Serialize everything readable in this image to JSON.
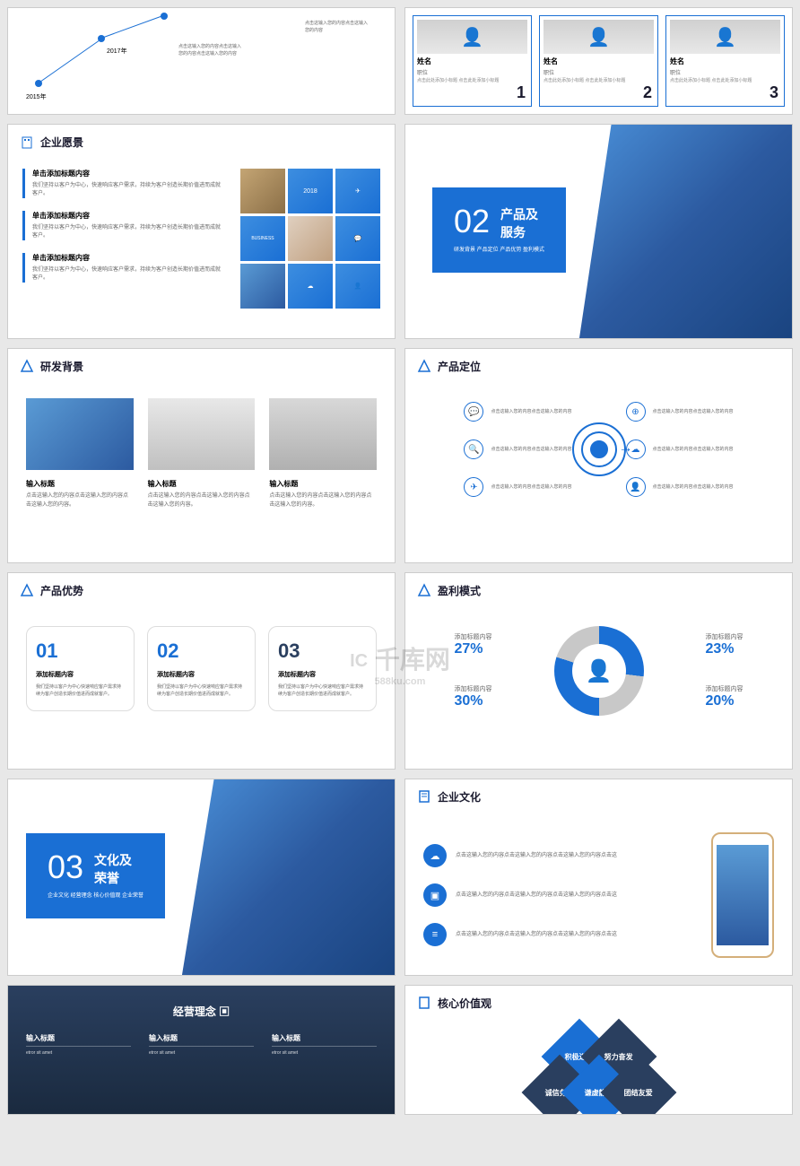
{
  "watermark": {
    "main": "千库网",
    "sub": "588ku.com",
    "logo": "IC"
  },
  "slides": {
    "s1": {
      "years": [
        "2015年",
        "2017年"
      ],
      "desc1": "点击这输入您的内容点击这输入您的内容",
      "desc2": "点击这输入您的内容点击这输入您的内容点击这输入您的内容"
    },
    "s2": {
      "cards": [
        {
          "name": "姓名",
          "role": "职位",
          "desc": "点击此处添加小标题\n点击此处添加小标题",
          "num": "1"
        },
        {
          "name": "姓名",
          "role": "职位",
          "desc": "点击此处添加小标题\n点击此处添加小标题",
          "num": "2"
        },
        {
          "name": "姓名",
          "role": "职位",
          "desc": "点击此处添加小标题\n点击此处添加小标题",
          "num": "3"
        }
      ]
    },
    "s3": {
      "title": "企业愿景",
      "items": [
        {
          "t": "单击添加标题内容",
          "d": "我们坚持以客户为中心，快速响应客户需求，持续为客户创造长期价值进而成就客户。"
        },
        {
          "t": "单击添加标题内容",
          "d": "我们坚持以客户为中心，快速响应客户需求，持续为客户创造长期价值进而成就客户。"
        },
        {
          "t": "单击添加标题内容",
          "d": "我们坚持以客户为中心，快速响应客户需求，持续为客户创造长期价值进而成就客户。"
        }
      ],
      "grid_labels": {
        "year": "2018",
        "business": "BUSINESS"
      }
    },
    "s4": {
      "num": "02",
      "title": "产品及服务",
      "sub": "研发背景 产品定位\n产品优势 盈利模式"
    },
    "s5": {
      "title": "研发背景",
      "cols": [
        {
          "t": "输入标题",
          "d": "点击这输入您的内容点击这输入您的内容点击这输入您的内容。"
        },
        {
          "t": "输入标题",
          "d": "点击这输入您的内容点击这输入您的内容点击这输入您的内容。"
        },
        {
          "t": "输入标题",
          "d": "点击这输入您的内容点击这输入您的内容点击这输入您的内容。"
        }
      ]
    },
    "s6": {
      "title": "产品定位",
      "left": [
        "点击这输入您的内容点击这输入您的内容",
        "点击这输入您的内容点击这输入您的内容",
        "点击这输入您的内容点击这输入您的内容"
      ],
      "right": [
        "点击这输入您的内容点击这输入您的内容",
        "点击这输入您的内容点击这输入您的内容",
        "点击这输入您的内容点击这输入您的内容"
      ]
    },
    "s7": {
      "title": "产品优势",
      "cards": [
        {
          "num": "01",
          "t": "添加标题内容",
          "d": "我们坚持以客户为中心快速响应客户需求持续为客户创造长期价值进而成就客户。"
        },
        {
          "num": "02",
          "t": "添加标题内容",
          "d": "我们坚持以客户为中心快速响应客户需求持续为客户创造长期价值进而成就客户。"
        },
        {
          "num": "03",
          "t": "添加标题内容",
          "d": "我们坚持以客户为中心快速响应客户需求持续为客户创造长期价值进而成就客户。"
        }
      ]
    },
    "s8": {
      "title": "盈利模式",
      "labels": [
        {
          "t": "添加标题内容",
          "v": "27%"
        },
        {
          "t": "添加标题内容",
          "v": "30%"
        },
        {
          "t": "添加标题内容",
          "v": "23%"
        },
        {
          "t": "添加标题内容",
          "v": "20%"
        }
      ]
    },
    "s9": {
      "num": "03",
      "title": "文化及荣誉",
      "sub": "企业文化 经营理念\n核心价值观 企业荣誉"
    },
    "s10": {
      "title": "企业文化",
      "items": [
        "点击这输入您的内容点击这输入您的内容点击这输入您的内容点击这",
        "点击这输入您的内容点击这输入您的内容点击这输入您的内容点击这",
        "点击这输入您的内容点击这输入您的内容点击这输入您的内容点击这"
      ]
    },
    "s11": {
      "title": "经营理念",
      "cols": [
        {
          "t": "输入标题",
          "d": "etror sit amet"
        },
        {
          "t": "输入标题",
          "d": "etror sit amet"
        },
        {
          "t": "输入标题",
          "d": "etror sit amet"
        }
      ]
    },
    "s12": {
      "title": "核心价值观",
      "values": [
        "积极进取",
        "努力奋发",
        "诚信务实",
        "谦虚静敏",
        "团结友爱"
      ]
    }
  },
  "chart_data": {
    "type": "pie",
    "title": "盈利模式",
    "series": [
      {
        "name": "添加标题内容",
        "value": 27
      },
      {
        "name": "添加标题内容",
        "value": 30
      },
      {
        "name": "添加标题内容",
        "value": 23
      },
      {
        "name": "添加标题内容",
        "value": 20
      }
    ]
  }
}
